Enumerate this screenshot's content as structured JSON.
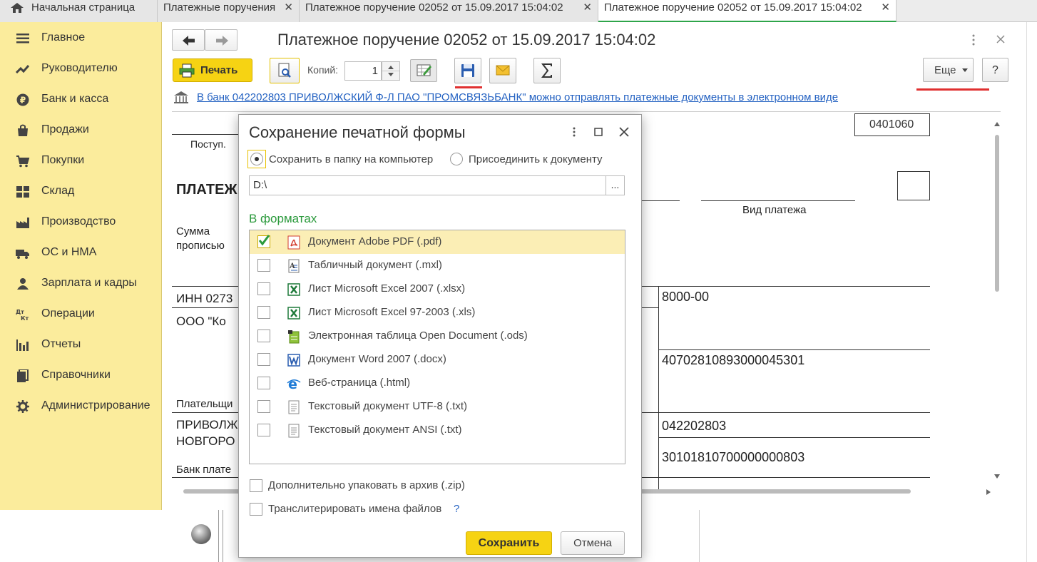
{
  "tabs": [
    {
      "label": "Начальная страница",
      "icon": "home-icon"
    },
    {
      "label": "Платежные поручения",
      "close": "✕"
    },
    {
      "label": "Платежное поручение 02052 от 15.09.2017 15:04:02",
      "close": "✕"
    },
    {
      "label": "Платежное поручение 02052 от 15.09.2017 15:04:02",
      "close": "✕",
      "active": true
    }
  ],
  "sidebar": {
    "items": [
      {
        "label": "Главное",
        "icon": "menu-icon"
      },
      {
        "label": "Руководителю",
        "icon": "trend-icon"
      },
      {
        "label": "Банк и касса",
        "icon": "ruble-icon"
      },
      {
        "label": "Продажи",
        "icon": "bag-icon"
      },
      {
        "label": "Покупки",
        "icon": "cart-icon"
      },
      {
        "label": "Склад",
        "icon": "warehouse-icon"
      },
      {
        "label": "Производство",
        "icon": "factory-icon"
      },
      {
        "label": "ОС и НМА",
        "icon": "truck-icon"
      },
      {
        "label": "Зарплата и кадры",
        "icon": "person-icon"
      },
      {
        "label": "Операции",
        "icon": "dt-kt-icon"
      },
      {
        "label": "Отчеты",
        "icon": "bar-chart-icon"
      },
      {
        "label": "Справочники",
        "icon": "books-icon"
      },
      {
        "label": "Администрирование",
        "icon": "gear-icon"
      }
    ]
  },
  "document": {
    "title": "Платежное поручение 02052 от 15.09.2017 15:04:02",
    "print_label": "Печать",
    "copies_label": "Копий:",
    "copies_value": "1",
    "more_label": "Еще",
    "help_label": "?",
    "bank_link": "В банк 042202803 ПРИВОЛЖСКИЙ Ф-Л ПАО \"ПРОМСВЯЗЬБАНК\" можно отправлять платежные документы в электронном виде"
  },
  "form": {
    "code": "0401060",
    "received": "Поступ.",
    "heading_partial": "ПЛАТЕЖ",
    "sum_words": "Сумма",
    "sum_words2": "прописью",
    "payment_type": "Вид платежа",
    "inn_partial": "ИНН 0273",
    "org_partial": "ООО \"Ко",
    "payer_partial": "Плательщи",
    "bank_partial1": "ПРИВОЛЖ",
    "bank_partial2": "НОВГОРО",
    "bank_payer_partial": "Банк плате",
    "amount": "8000-00",
    "account": "40702810893000045301",
    "bik": "042202803",
    "corr_account": "30101810700000000803"
  },
  "dialog": {
    "title": "Сохранение печатной формы",
    "radio_save_folder": "Сохранить в папку на компьютер",
    "radio_attach": "Присоединить к документу",
    "path_value": "D:\\",
    "path_button": "...",
    "formats_title": "В форматах",
    "formats": [
      {
        "label": "Документ Adobe PDF (.pdf)",
        "icon": "pdf-icon",
        "checked": true
      },
      {
        "label": "Табличный документ (.mxl)",
        "icon": "mxl-icon",
        "checked": false
      },
      {
        "label": "Лист Microsoft Excel 2007 (.xlsx)",
        "icon": "excel-icon",
        "checked": false
      },
      {
        "label": "Лист Microsoft Excel 97-2003 (.xls)",
        "icon": "excel-icon",
        "checked": false
      },
      {
        "label": "Электронная таблица Open Document (.ods)",
        "icon": "ods-icon",
        "checked": false
      },
      {
        "label": "Документ Word 2007 (.docx)",
        "icon": "word-icon",
        "checked": false
      },
      {
        "label": "Веб-страница (.html)",
        "icon": "ie-icon",
        "checked": false
      },
      {
        "label": "Текстовый документ UTF-8 (.txt)",
        "icon": "txt-icon",
        "checked": false
      },
      {
        "label": "Текстовый документ ANSI (.txt)",
        "icon": "txt-icon",
        "checked": false
      }
    ],
    "zip_label": "Дополнительно упаковать в архив (.zip)",
    "translit_label": "Транслитерировать имена файлов",
    "help_mark": "?",
    "save_label": "Сохранить",
    "cancel_label": "Отмена"
  },
  "colors": {
    "sidebar_bg": "#fbec9c",
    "accent_yellow": "#f6d313",
    "link_blue": "#2462c2",
    "formats_green": "#2b9a3c",
    "active_tab_underline": "#2ea54a"
  }
}
